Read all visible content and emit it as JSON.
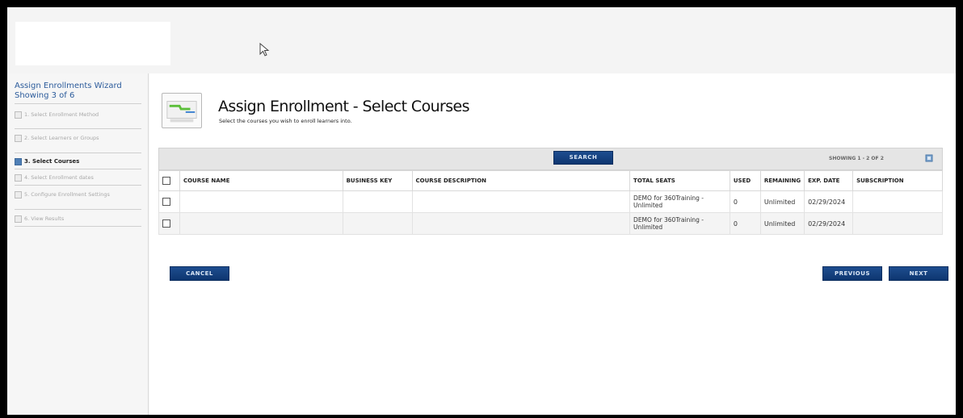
{
  "sidebar": {
    "title": "Assign Enrollments Wizard",
    "progress": "Showing 3 of 6",
    "steps": [
      {
        "label": "1. Select Enrollment Method",
        "active": false
      },
      {
        "label": "2. Select Learners or Groups",
        "active": false
      },
      {
        "label": "3. Select Courses",
        "active": true
      },
      {
        "label": "4. Select Enrollment dates",
        "active": false
      },
      {
        "label": "5. Configure Enrollment Settings",
        "active": false
      },
      {
        "label": "6. View Results",
        "active": false
      }
    ]
  },
  "header": {
    "title": "Assign Enrollment - Select Courses",
    "subtitle": "Select the courses you wish to enroll learners into."
  },
  "toolbar": {
    "search_label": "SEARCH",
    "showing": "SHOWING 1 - 2 OF 2"
  },
  "table": {
    "columns": [
      "COURSE NAME",
      "BUSINESS KEY",
      "COURSE DESCRIPTION",
      "TOTAL SEATS",
      "USED",
      "REMAINING",
      "EXP. DATE",
      "SUBSCRIPTION"
    ],
    "rows": [
      {
        "course_name": "",
        "business_key": "",
        "description": "",
        "total_seats": "DEMO for 360Training - Unlimited",
        "used": "0",
        "remaining": "Unlimited",
        "exp_date": "02/29/2024",
        "subscription": ""
      },
      {
        "course_name": "",
        "business_key": "",
        "description": "",
        "total_seats": "DEMO for 360Training - Unlimited",
        "used": "0",
        "remaining": "Unlimited",
        "exp_date": "02/29/2024",
        "subscription": ""
      }
    ]
  },
  "footer": {
    "cancel_label": "CANCEL",
    "previous_label": "PREVIOUS",
    "next_label": "NEXT"
  },
  "colors": {
    "button": "#1a4785",
    "accent": "#2b5b9b",
    "active_step": "#4e7fb6"
  }
}
